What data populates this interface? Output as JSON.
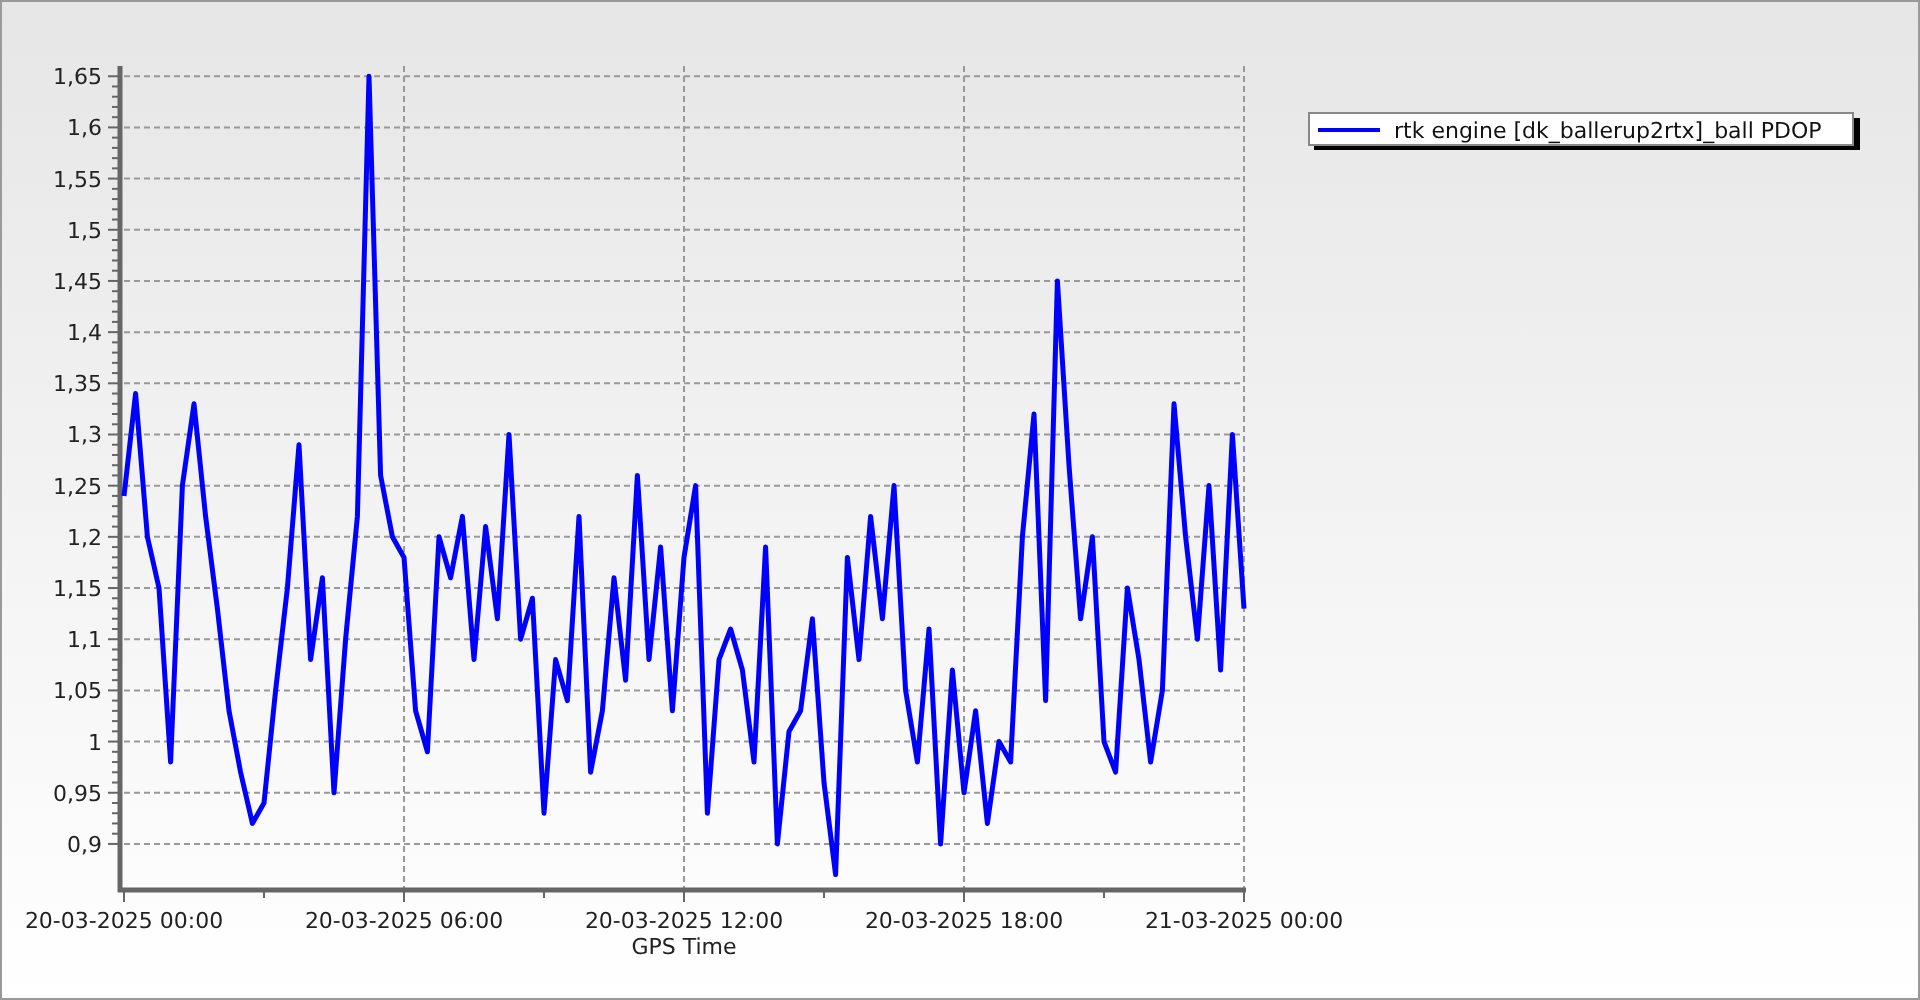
{
  "chart_data": {
    "type": "line",
    "xlabel": "GPS Time",
    "grid": true,
    "categories": [
      "20-03-2025 00:00",
      null,
      null,
      null,
      null,
      null,
      null,
      null,
      null,
      null,
      null,
      null,
      null,
      null,
      null,
      null,
      null,
      null,
      null,
      null,
      null,
      null,
      null,
      null,
      "20-03-2025 06:00",
      null,
      null,
      null,
      null,
      null,
      null,
      null,
      null,
      null,
      null,
      null,
      null,
      null,
      null,
      null,
      null,
      null,
      null,
      null,
      null,
      null,
      null,
      null,
      "20-03-2025 12:00",
      null,
      null,
      null,
      null,
      null,
      null,
      null,
      null,
      null,
      null,
      null,
      null,
      null,
      null,
      null,
      null,
      null,
      null,
      null,
      null,
      null,
      null,
      null,
      "20-03-2025 18:00",
      null,
      null,
      null,
      null,
      null,
      null,
      null,
      null,
      null,
      null,
      null,
      null,
      null,
      null,
      null,
      null,
      null,
      null,
      null,
      null,
      null,
      null,
      null,
      "21-03-2025 00:00"
    ],
    "series": [
      {
        "name": "rtk engine [dk_ballerup2rtx]_ball PDOP",
        "color": "#0000ff",
        "values": [
          1.24,
          1.34,
          1.2,
          1.15,
          0.98,
          1.25,
          1.33,
          1.22,
          1.13,
          1.03,
          0.97,
          0.92,
          0.94,
          1.05,
          1.15,
          1.29,
          1.08,
          1.16,
          0.95,
          1.1,
          1.22,
          1.65,
          1.26,
          1.2,
          1.18,
          1.03,
          0.99,
          1.2,
          1.16,
          1.22,
          1.08,
          1.21,
          1.12,
          1.3,
          1.1,
          1.14,
          0.93,
          1.08,
          1.04,
          1.22,
          0.97,
          1.03,
          1.16,
          1.06,
          1.26,
          1.08,
          1.19,
          1.03,
          1.18,
          1.25,
          0.93,
          1.08,
          1.11,
          1.07,
          0.98,
          1.19,
          0.9,
          1.01,
          1.03,
          1.12,
          0.96,
          0.87,
          1.18,
          1.08,
          1.22,
          1.12,
          1.25,
          1.05,
          0.98,
          1.11,
          0.9,
          1.07,
          0.95,
          1.03,
          0.92,
          1,
          0.98,
          1.2,
          1.32,
          1.04,
          1.45,
          1.27,
          1.12,
          1.2,
          1,
          0.97,
          1.15,
          1.08,
          0.98,
          1.05,
          1.33,
          1.2,
          1.1,
          1.25,
          1.07,
          1.3,
          1.13
        ]
      }
    ],
    "ylim": [
      0.855,
      1.66
    ],
    "yticks": [
      {
        "value": 0.9,
        "label": "0,9"
      },
      {
        "value": 0.95,
        "label": "0,95"
      },
      {
        "value": 1,
        "label": "1"
      },
      {
        "value": 1.05,
        "label": "1,05"
      },
      {
        "value": 1.1,
        "label": "1,1"
      },
      {
        "value": 1.15,
        "label": "1,15"
      },
      {
        "value": 1.2,
        "label": "1,2"
      },
      {
        "value": 1.25,
        "label": "1,25"
      },
      {
        "value": 1.3,
        "label": "1,3"
      },
      {
        "value": 1.35,
        "label": "1,35"
      },
      {
        "value": 1.4,
        "label": "1,4"
      },
      {
        "value": 1.45,
        "label": "1,45"
      },
      {
        "value": 1.5,
        "label": "1,5"
      },
      {
        "value": 1.55,
        "label": "1,55"
      },
      {
        "value": 1.6,
        "label": "1,6"
      },
      {
        "value": 1.65,
        "label": "1,65"
      }
    ]
  }
}
